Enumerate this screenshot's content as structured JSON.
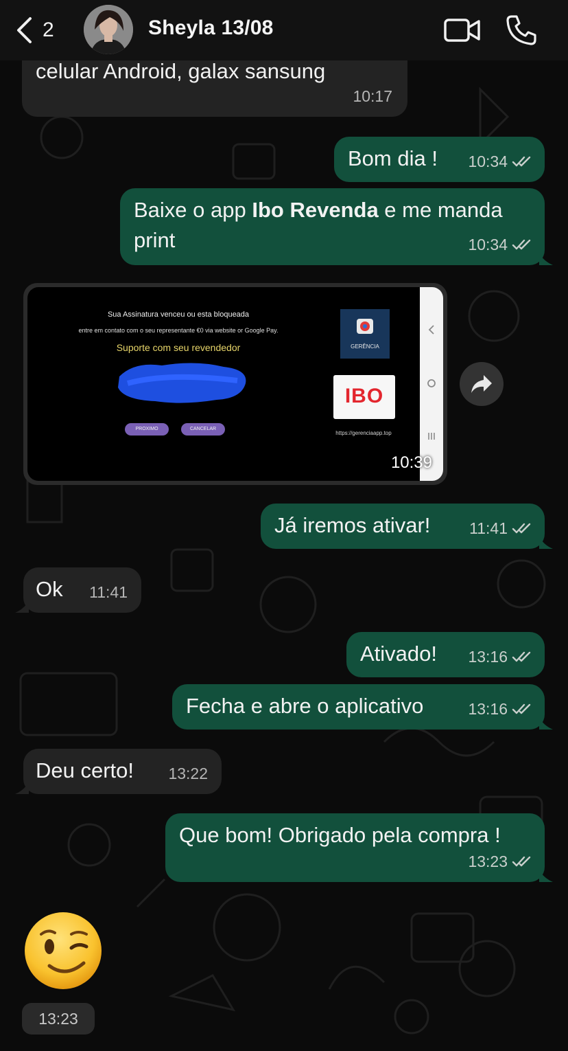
{
  "header": {
    "back_count": "2",
    "contact_name": "Sheyla 13/08"
  },
  "messages": [
    {
      "dir": "in",
      "text": "celular Android, galax sansung",
      "time": "10:17"
    },
    {
      "dir": "out",
      "text": "Bom dia !",
      "time": "10:34",
      "status": "read"
    },
    {
      "dir": "out",
      "text_before": "Baixe o app ",
      "text_bold": "Ibo Revenda",
      "text_after": " e me manda",
      "text_line2": "print",
      "time": "10:34",
      "status": "read"
    },
    {
      "dir": "in",
      "type": "image",
      "time": "10:39",
      "screenshot": {
        "line1": "Sua Assinatura venceu ou esta bloqueada",
        "line2": "entre em contato com o seu representante €0 via website or Google Pay.",
        "support": "Suporte com seu revendedor",
        "btn_next": "PROXIMO",
        "btn_cancel": "CANCELAR",
        "tile_label": "GERÊNCIA",
        "ibo_logo": "IBO",
        "url": "https://gerenciaapp.top"
      }
    },
    {
      "dir": "out",
      "text": "Já iremos ativar!",
      "time": "11:41",
      "status": "read"
    },
    {
      "dir": "in",
      "text": "Ok",
      "time": "11:41"
    },
    {
      "dir": "out",
      "text": "Ativado!",
      "time": "13:16",
      "status": "read"
    },
    {
      "dir": "out",
      "text": "Fecha e abre o aplicativo",
      "time": "13:16",
      "status": "read"
    },
    {
      "dir": "in",
      "text": "Deu certo!",
      "time": "13:22"
    },
    {
      "dir": "out",
      "text": "Que bom! Obrigado pela compra !",
      "time": "13:23",
      "status": "read"
    },
    {
      "dir": "in",
      "type": "emoji",
      "emoji": "winking-face",
      "time": "13:23"
    }
  ],
  "colors": {
    "outgoing_bubble": "#12503c",
    "incoming_bubble": "#232323",
    "read_ticks": "#c9cfcc"
  }
}
